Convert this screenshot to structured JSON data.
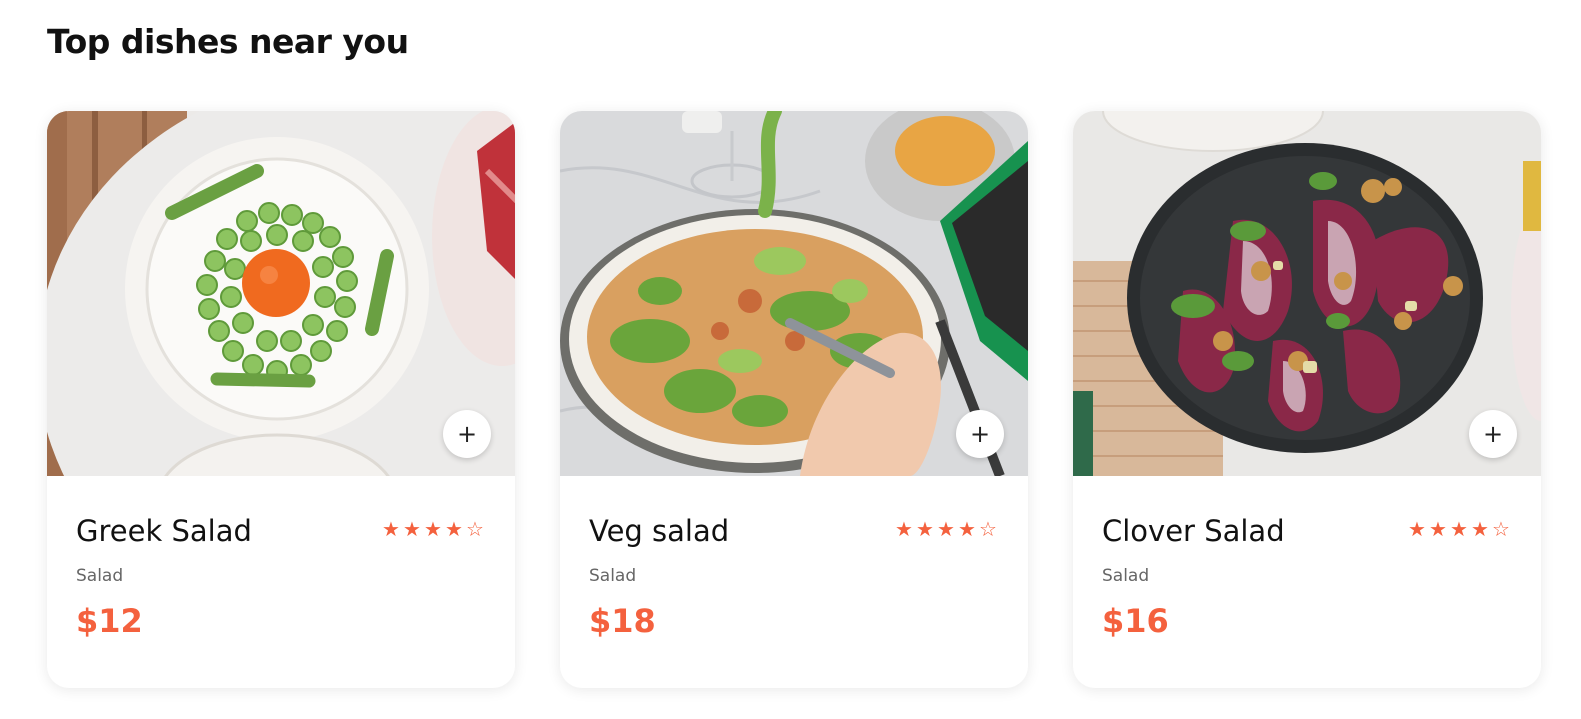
{
  "section": {
    "title": "Top dishes near you"
  },
  "colors": {
    "accent": "#f4613e",
    "muted_text": "#666666"
  },
  "dishes": [
    {
      "name": "Greek Salad",
      "category": "Salad",
      "price": "$12",
      "rating": 4,
      "rating_max": 5,
      "image": "greek-salad-photo"
    },
    {
      "name": "Veg salad",
      "category": "Salad",
      "price": "$18",
      "rating": 4,
      "rating_max": 5,
      "image": "veg-salad-photo"
    },
    {
      "name": "Clover Salad",
      "category": "Salad",
      "price": "$16",
      "rating": 4,
      "rating_max": 5,
      "image": "clover-salad-photo"
    }
  ],
  "icons": {
    "add": "+",
    "star_full": "★",
    "star_empty": "☆"
  }
}
